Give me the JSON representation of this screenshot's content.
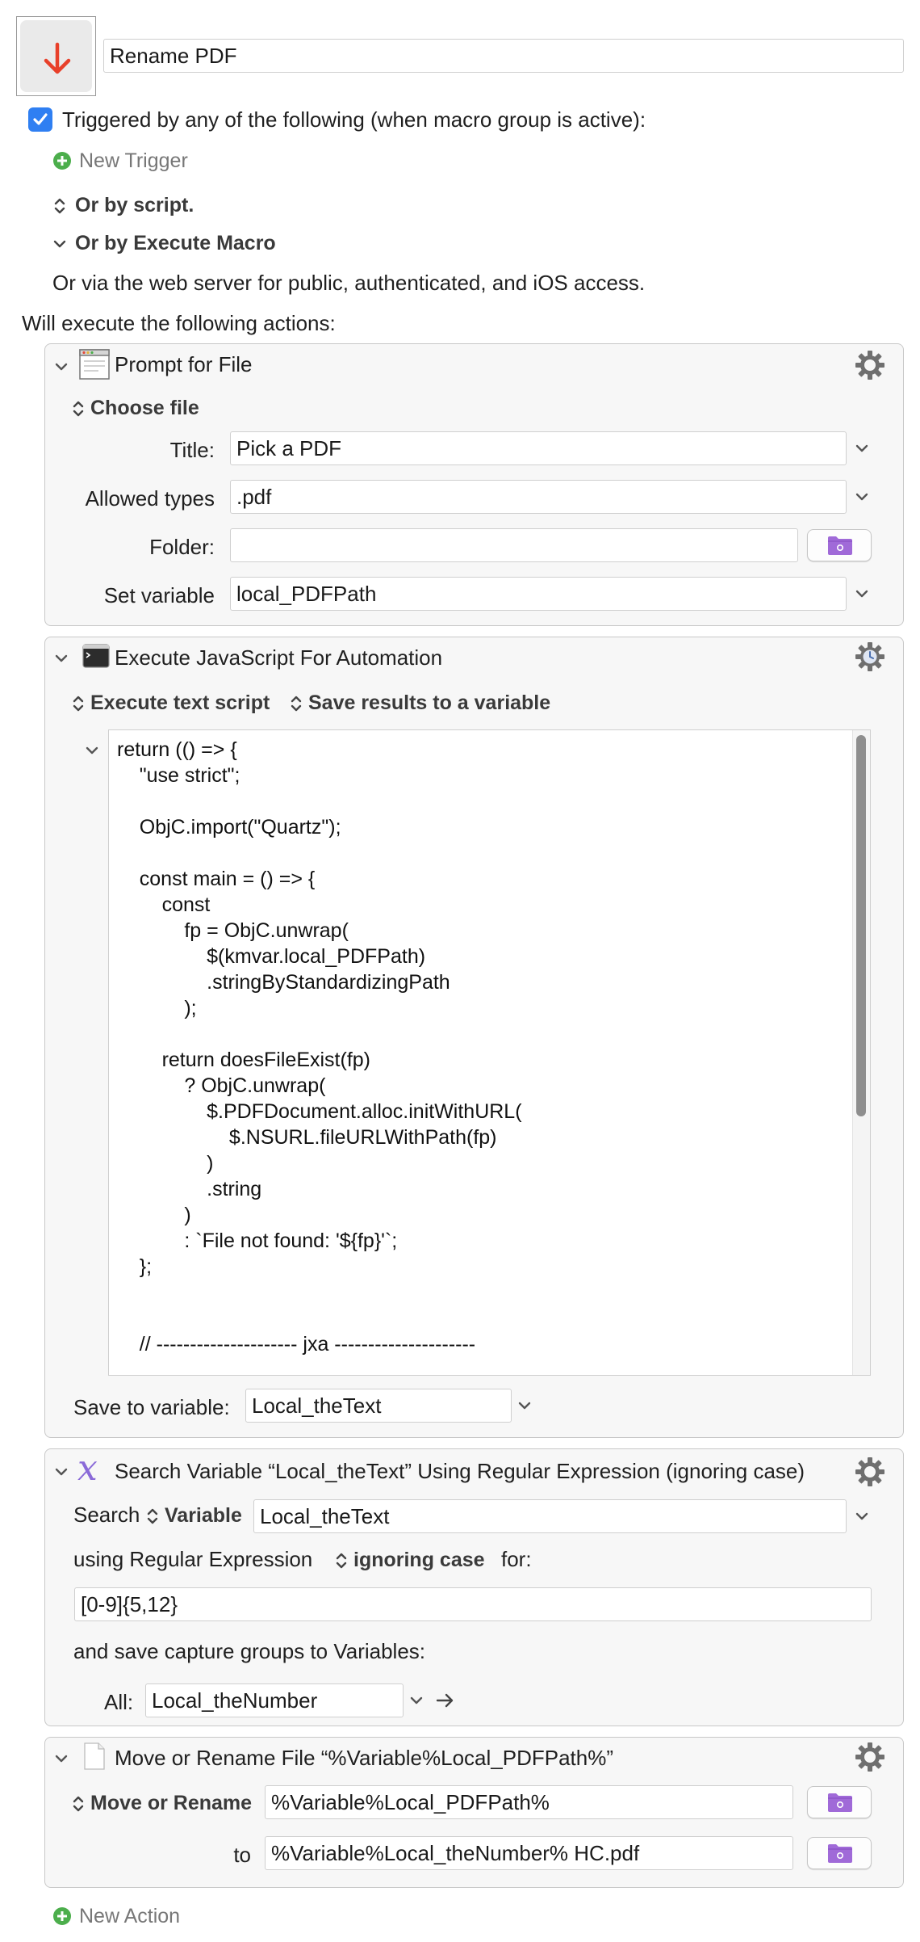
{
  "macro": {
    "name": "Rename PDF",
    "trigger_text": "Triggered by any of the following (when macro group is active):",
    "new_trigger": "New Trigger",
    "or_by_script": "Or by script.",
    "or_by_execute": "Or by Execute Macro",
    "web_server": "Or via the web server for public, authenticated, and iOS access.",
    "will_execute": "Will execute the following actions:",
    "new_action": "New Action"
  },
  "actions": {
    "prompt": {
      "title": "Prompt for File",
      "mode": "Choose file",
      "title_label": "Title:",
      "title_value": "Pick a PDF",
      "types_label": "Allowed types",
      "types_value": ".pdf",
      "folder_label": "Folder:",
      "folder_value": "",
      "var_label": "Set variable",
      "var_value": "local_PDFPath"
    },
    "jxa": {
      "title": "Execute JavaScript For Automation",
      "mode": "Execute text script",
      "results": "Save results to a variable",
      "code": [
        "return (() => {",
        "    \"use strict\";",
        "",
        "    ObjC.import(\"Quartz\");",
        "",
        "    const main = () => {",
        "        const",
        "            fp = ObjC.unwrap(",
        "                $(kmvar.local_PDFPath)",
        "                .stringByStandardizingPath",
        "            );",
        "",
        "        return doesFileExist(fp)",
        "            ? ObjC.unwrap(",
        "                $.PDFDocument.alloc.initWithURL(",
        "                    $.NSURL.fileURLWithPath(fp)",
        "                )",
        "                .string",
        "            )",
        "            : `File not found: '${fp}'`;",
        "    };",
        "",
        "",
        "    // --------------------- jxa ---------------------"
      ],
      "save_label": "Save to variable:",
      "save_value": "Local_theText"
    },
    "search": {
      "title": "Search Variable “Local_theText” Using Regular Expression (ignoring case)",
      "search_label": "Search",
      "source": "Variable",
      "source_value": "Local_theText",
      "using_label": "using Regular Expression",
      "case_mode": "ignoring case",
      "for_label": "for:",
      "regex": "[0-9]{5,12}",
      "save_groups": "and save capture groups to Variables:",
      "all_label": "All:",
      "all_value": "Local_theNumber"
    },
    "move": {
      "title": "Move or Rename File “%Variable%Local_PDFPath%”",
      "mode": "Move or Rename",
      "from_value": "%Variable%Local_PDFPath%",
      "to_label": "to",
      "to_value": "%Variable%Local_theNumber% HC.pdf"
    }
  },
  "colors": {
    "arrow": "#e8402a",
    "checkbox": "#2f7ff2",
    "plus": "#4cae4c",
    "folder": "#a06ad8"
  }
}
